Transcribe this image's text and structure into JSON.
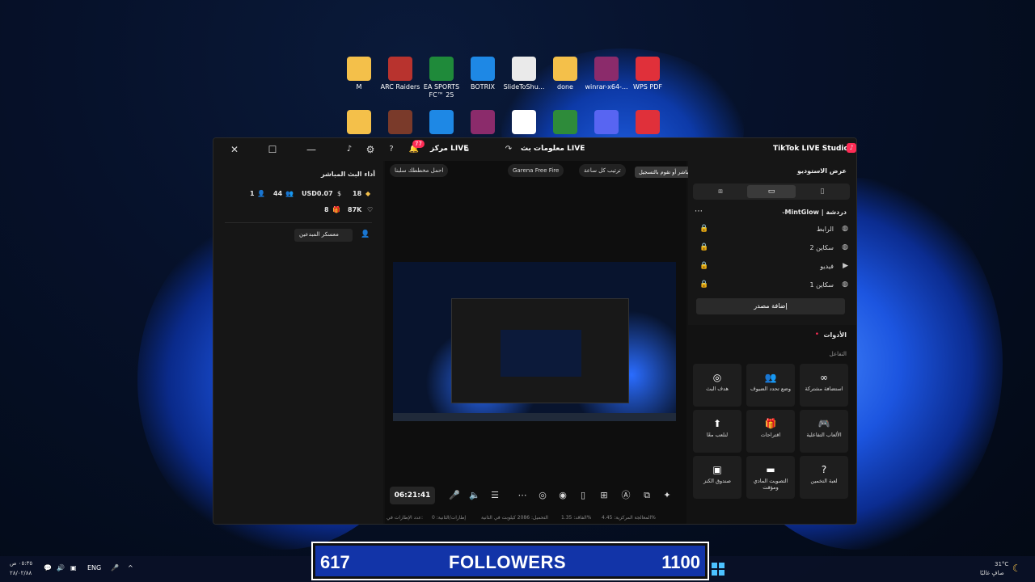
{
  "desktop": {
    "icons_row1": [
      {
        "label": "M",
        "color": "#f4c04a"
      },
      {
        "label": "ARC Raiders",
        "color": "#b8332e"
      },
      {
        "label": "EA SPORTS FC™ 25",
        "color": "#1f8a3a"
      },
      {
        "label": "BOTRIX",
        "color": "#1e88e5"
      },
      {
        "label": "SlideToShu...",
        "color": "#eaeaea"
      },
      {
        "label": "done",
        "color": "#f4c04a"
      },
      {
        "label": "winrar-x64-...",
        "color": "#8b2b6b"
      },
      {
        "label": "WPS PDF",
        "color": "#e0303a"
      }
    ],
    "icons_row2_colors": [
      "#f4c04a",
      "#7a3a2a",
      "#1e88e5",
      "#8b2b6b",
      "#ffffff",
      "#2e8b3a",
      "#5865f2",
      "#e0303a"
    ]
  },
  "window": {
    "app_title": "TikTok LIVE Studio",
    "stream_info": "معلومات بث LIVE",
    "live_center": "مركز LIVE",
    "notif_count": "77",
    "close_icon": "✕",
    "maximize_icon": "☐",
    "minimize_icon": "—"
  },
  "left": {
    "title": "أداء البث المباشر",
    "stats": {
      "diamonds": "18",
      "usd": "USD0.07",
      "viewers": "44",
      "new_followers": "1",
      "likes": "87K",
      "gifts": "8"
    },
    "camp_button": "معسكر المبدعين"
  },
  "center": {
    "chips": [
      {
        "text": "احمل مخططك سلبنا"
      },
      {
        "text": "Garena Free Fire"
      },
      {
        "text": "ترتيب كل ساعة"
      }
    ],
    "tooltip": "لا يمكن تغيير اتجاه عرض الشاشة عندما تكون في بث مباشر أو تقوم بالتسجيل.",
    "timer": "06:21:41",
    "stats": [
      "المعالجة المركزية: 4.45%",
      "الفاقد: 1.35%",
      "التحميل: 2086 كيلوبت في الثانية",
      "إطارات/الثانية: 0",
      "عدد الإطارات في:"
    ]
  },
  "right": {
    "studio_title": "عرض الاستوديو",
    "scene_title": "MintGlow | دردشة",
    "sources": [
      {
        "name": "الرابط",
        "icon": "globe-icon"
      },
      {
        "name": "سكاين 2",
        "icon": "globe-icon"
      },
      {
        "name": "فيديو",
        "icon": "play-icon"
      },
      {
        "name": "سكاين 1",
        "icon": "globe-icon"
      }
    ],
    "add_source": "إضافة مصدر",
    "tools_title": "الأدوات",
    "interaction_label": "التفاعل",
    "tools": [
      {
        "label": "استضافة مشتركة",
        "glyph": "∞"
      },
      {
        "label": "وضع تحدد الضيوف",
        "glyph": "👥"
      },
      {
        "label": "هدف البث",
        "glyph": "◎"
      },
      {
        "label": "الألعاب التفاعلية",
        "glyph": "🎮"
      },
      {
        "label": "اقتراحات",
        "glyph": "🎁"
      },
      {
        "label": "لنلعب معًا",
        "glyph": "⬆"
      },
      {
        "label": "لعبة التخمين",
        "glyph": "?"
      },
      {
        "label": "التصويت المادي ومؤقت",
        "glyph": "▬"
      },
      {
        "label": "صندوق الكنز",
        "glyph": "▣"
      }
    ]
  },
  "banner": {
    "current": "617",
    "label": "FOLLOWERS",
    "goal": "1100"
  },
  "taskbar": {
    "time": "٠٥:٣٥ ص",
    "date": "٢٨/٠٢/٨٨",
    "lang": "ENG",
    "temp": "31°C",
    "weather": "صافٍ غالبًا"
  }
}
